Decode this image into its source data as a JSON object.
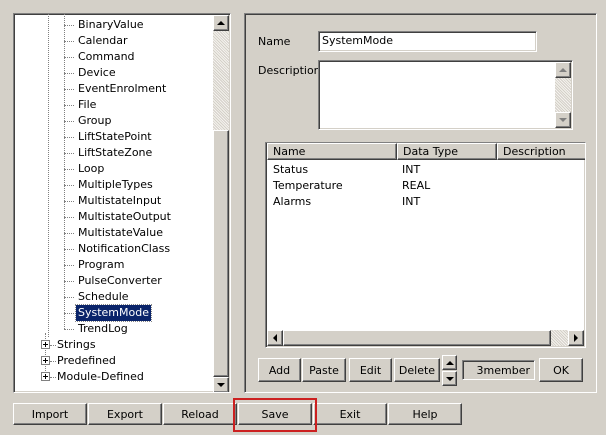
{
  "tree": {
    "object_types": [
      "BinaryValue",
      "Calendar",
      "Command",
      "Device",
      "EventEnrolment",
      "File",
      "Group",
      "LiftStatePoint",
      "LiftStateZone",
      "Loop",
      "MultipleTypes",
      "MultistateInput",
      "MultistateOutput",
      "MultistateValue",
      "NotificationClass",
      "Program",
      "PulseConverter",
      "Schedule",
      "SystemMode",
      "TrendLog"
    ],
    "selected": "SystemMode",
    "groups": [
      "Strings",
      "Predefined",
      "Module-Defined"
    ]
  },
  "detail": {
    "name_label": "Name",
    "name_value": "SystemMode",
    "description_label": "Description",
    "description_value": ""
  },
  "members": {
    "columns": [
      "Name",
      "Data Type",
      "Description"
    ],
    "rows": [
      {
        "name": "Status",
        "data_type": "INT",
        "description": ""
      },
      {
        "name": "Temperature",
        "data_type": "REAL",
        "description": ""
      },
      {
        "name": "Alarms",
        "data_type": "INT",
        "description": ""
      }
    ]
  },
  "member_actions": {
    "add": "Add",
    "paste": "Paste",
    "edit": "Edit",
    "delete": "Delete",
    "count": "3member",
    "ok": "OK"
  },
  "bottom_bar": {
    "import": "Import",
    "export": "Export",
    "reload": "Reload",
    "save": "Save",
    "exit": "Exit",
    "help": "Help"
  },
  "colors": {
    "face": "#d4d0c8",
    "selection": "#0a246a",
    "highlight_marker": "#cc2020"
  }
}
